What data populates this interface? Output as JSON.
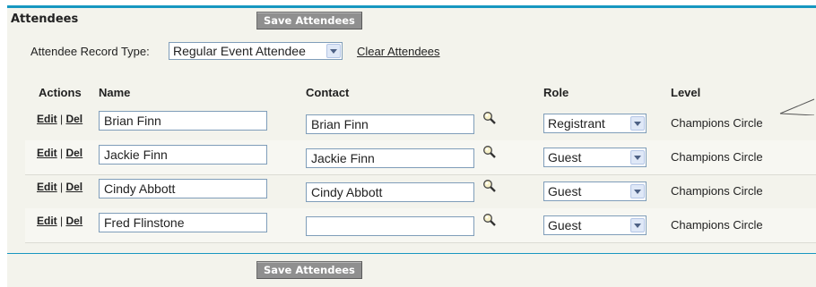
{
  "section": {
    "title": "Attendees",
    "save_label": "Save Attendees"
  },
  "record_type": {
    "label": "Attendee Record Type:",
    "selected": "Regular Event Attendee",
    "clear_label": "Clear Attendees"
  },
  "columns": {
    "actions": "Actions",
    "name": "Name",
    "contact": "Contact",
    "role": "Role",
    "level": "Level"
  },
  "row_actions": {
    "edit": "Edit",
    "sep": " | ",
    "del": "Del"
  },
  "rows": [
    {
      "name": "Brian Finn",
      "contact": "Brian Finn",
      "role": "Registrant",
      "level": "Champions Circle"
    },
    {
      "name": "Jackie Finn",
      "contact": "Jackie Finn",
      "role": "Guest",
      "level": "Champions Circle"
    },
    {
      "name": "Cindy Abbott",
      "contact": "Cindy Abbott",
      "role": "Guest",
      "level": "Champions Circle"
    },
    {
      "name": "Fred Flinstone",
      "contact": "",
      "role": "Guest",
      "level": "Champions Circle"
    }
  ],
  "icons": {
    "lookup": "magnifier-lookup-icon",
    "dropdown": "chevron-down-icon"
  },
  "colors": {
    "accent": "#1797c0",
    "panel_bg": "#f3f3ec",
    "button_bg": "#8f8f8f"
  }
}
